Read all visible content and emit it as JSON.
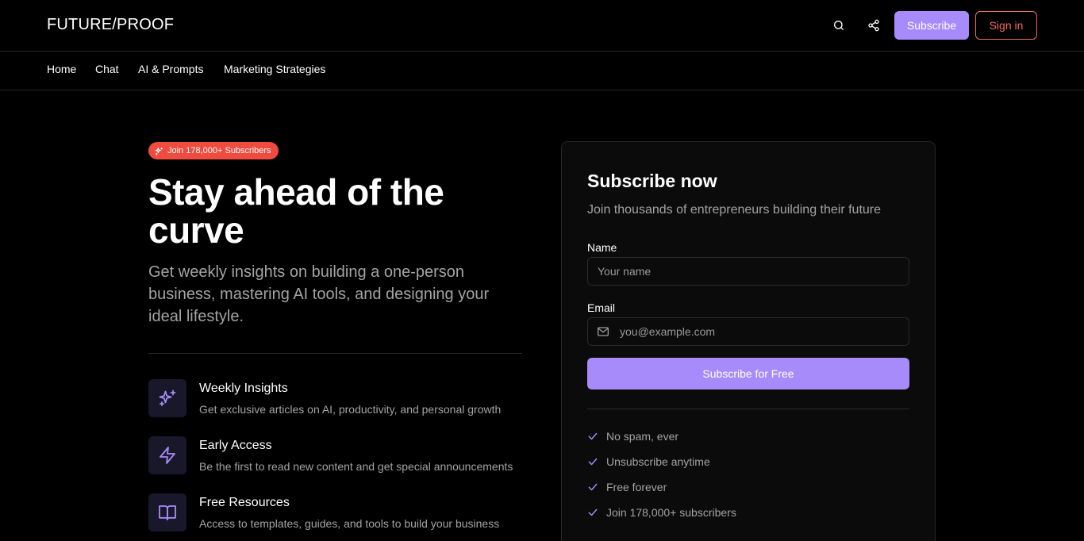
{
  "header": {
    "brand": "FUTURE/PROOF",
    "search_icon": "search-icon",
    "share_icon": "share-icon",
    "subscribe_label": "Subscribe",
    "signin_label": "Sign in"
  },
  "nav": {
    "items": [
      {
        "label": "Home"
      },
      {
        "label": "Chat"
      },
      {
        "label": "AI & Prompts"
      },
      {
        "label": "Marketing Strategies"
      }
    ]
  },
  "hero": {
    "badge": "Join 178,000+ Subscribers",
    "title": "Stay ahead of the curve",
    "subtitle": "Get weekly insights on building a one-person business, mastering AI tools, and designing your ideal lifestyle."
  },
  "features": [
    {
      "icon": "sparkles-icon",
      "title": "Weekly Insights",
      "desc": "Get exclusive articles on AI, productivity, and personal growth"
    },
    {
      "icon": "lightning-icon",
      "title": "Early Access",
      "desc": "Be the first to read new content and get special announcements"
    },
    {
      "icon": "book-icon",
      "title": "Free Resources",
      "desc": "Access to templates, guides, and tools to build your business"
    }
  ],
  "form": {
    "title": "Subscribe now",
    "subtitle": "Join thousands of entrepreneurs building their future",
    "name_label": "Name",
    "name_placeholder": "Your name",
    "email_label": "Email",
    "email_placeholder": "you@example.com",
    "submit_label": "Subscribe for Free",
    "checks": [
      "No spam, ever",
      "Unsubscribe anytime",
      "Free forever",
      "Join 178,000+ subscribers"
    ]
  },
  "colors": {
    "accent": "#a78bfa",
    "badge": "#ef4b3f",
    "signin": "#f26a5a",
    "background": "#000000"
  }
}
